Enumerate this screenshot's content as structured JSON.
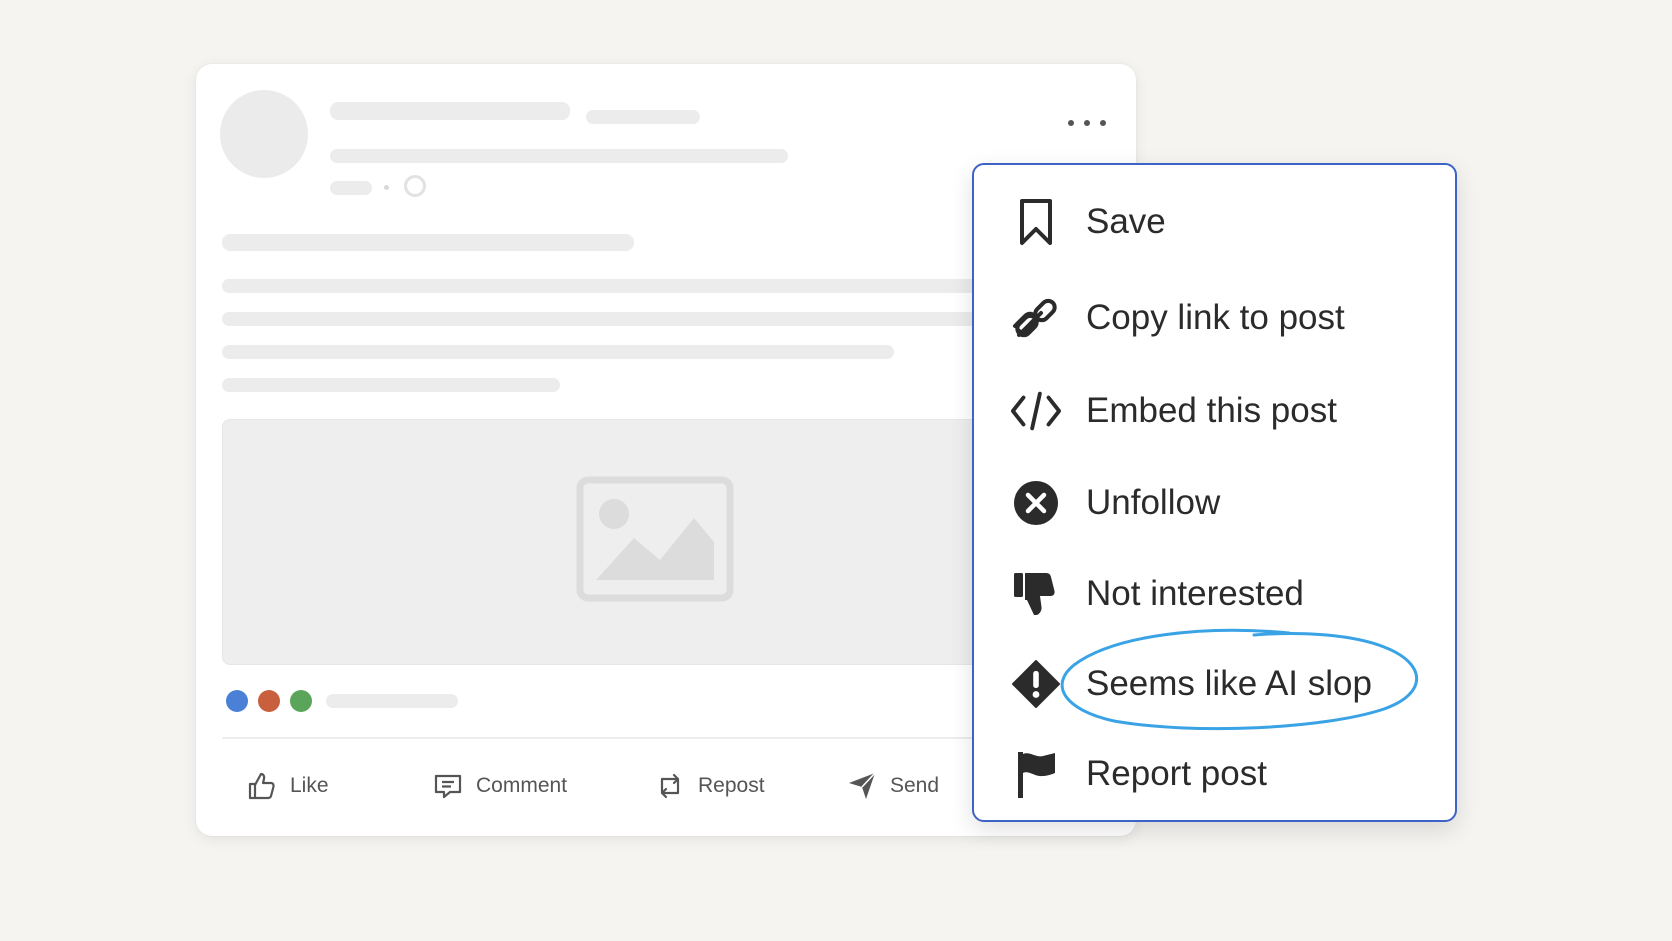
{
  "post": {
    "actions": [
      {
        "label": "Like",
        "icon": "thumbs-up-icon"
      },
      {
        "label": "Comment",
        "icon": "comment-icon"
      },
      {
        "label": "Repost",
        "icon": "repost-icon"
      },
      {
        "label": "Send",
        "icon": "send-icon"
      }
    ],
    "reaction_colors": [
      "#4a80d6",
      "#c9603d",
      "#5aa55a"
    ]
  },
  "menu": {
    "items": [
      {
        "label": "Save",
        "icon": "bookmark-icon"
      },
      {
        "label": "Copy link to post",
        "icon": "link-icon"
      },
      {
        "label": "Embed this post",
        "icon": "code-icon"
      },
      {
        "label": "Unfollow",
        "icon": "close-circle-icon"
      },
      {
        "label": "Not interested",
        "icon": "thumbs-down-icon"
      },
      {
        "label": "Seems like AI slop",
        "icon": "warning-diamond-icon"
      },
      {
        "label": "Report post",
        "icon": "flag-icon"
      }
    ],
    "highlighted_item": "Seems like AI slop",
    "border_color": "#3e63c7",
    "highlight_color": "#3aa3e6"
  }
}
